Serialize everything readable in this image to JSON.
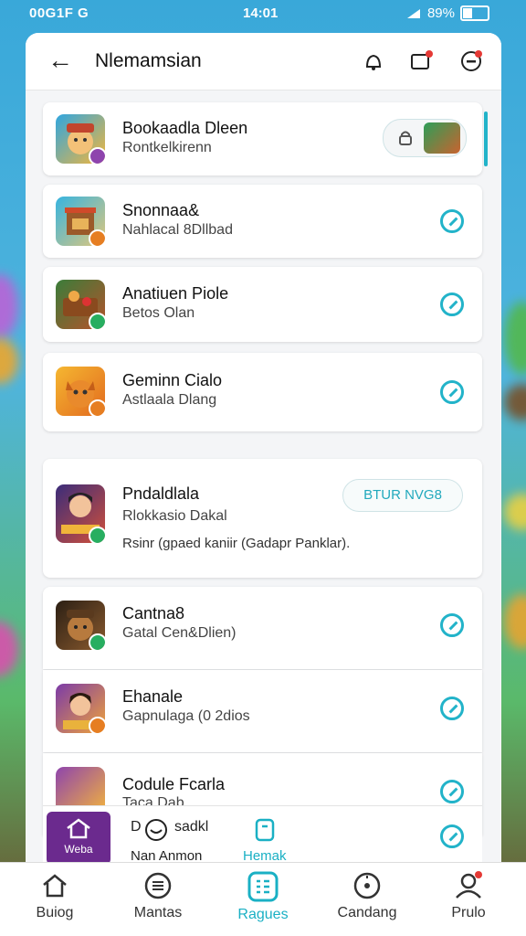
{
  "status": {
    "left": "00G1F G",
    "time": "14:01",
    "battery": "89%"
  },
  "header": {
    "title": "Nlemamsian"
  },
  "list": [
    {
      "name": "Bookaadla Dleen",
      "sub": "Rontkelkirenn"
    },
    {
      "name": "Snonnaa&",
      "sub": "Nahlacal 8Dllbad"
    },
    {
      "name": "Anatiuen Piole",
      "sub": "Betos Olan"
    },
    {
      "name": "Geminn Cialo",
      "sub": "Astlaala Dlang"
    }
  ],
  "featured": {
    "name": "Pndaldlala",
    "sub": "Rlokkasio Dakal",
    "desc": "Rsinr (gpaed kaniir (Gadapr Panklar).",
    "button": "BTUR NVG8"
  },
  "list2": [
    {
      "name": "Cantna8",
      "sub": "Gatal Cen&Dlien)"
    },
    {
      "name": "Ehanale",
      "sub": "Gapnulaga (0 2dios"
    },
    {
      "name": "Codule Fcarla",
      "sub": "Taca Dab"
    }
  ],
  "mini_bar": {
    "label_a": "D",
    "label_b": "sadkl",
    "label_c": "Nan Anmon",
    "label_d": "Hemak",
    "home_label": "Weba"
  },
  "nav": [
    {
      "label": "Buiog",
      "icon": "home-icon"
    },
    {
      "label": "Mantas",
      "icon": "menu-icon"
    },
    {
      "label": "Ragues",
      "icon": "grid-icon",
      "active": true
    },
    {
      "label": "Candang",
      "icon": "compass-icon"
    },
    {
      "label": "Prulo",
      "icon": "user-icon"
    }
  ],
  "colors": {
    "accent": "#22b3c9",
    "active_nav": "#1ab0c4",
    "notify": "#e53935"
  }
}
